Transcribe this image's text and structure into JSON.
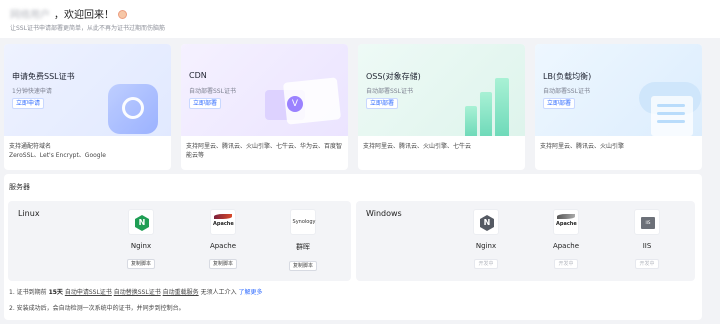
{
  "welcome": {
    "username": "网络用户",
    "greeting": "，欢迎回来！",
    "subtitle": "让SSL证书申请部署更简单，从此不再为证书过期而伤脑筋"
  },
  "cards": [
    {
      "title": "申请免费SSL证书",
      "desc": "1分钟快速申请",
      "button": "立即申请",
      "footer": "支持通配符域名\nZeroSSL、Let's Encrypt、Google"
    },
    {
      "title": "CDN",
      "desc": "自动部署SSL证书",
      "button": "立即部署",
      "footer": "支持阿里云、腾讯云、火山引擎、七牛云、华为云、百度智能云等"
    },
    {
      "title": "OSS(对象存储)",
      "desc": "自动部署SSL证书",
      "button": "立即部署",
      "footer": "支持阿里云、腾讯云、火山引擎、七牛云"
    },
    {
      "title": "LB(负载均衡)",
      "desc": "自动部署SSL证书",
      "button": "立即部署",
      "footer": "支持阿里云、腾讯云、火山引擎"
    }
  ],
  "servers": {
    "title": "服务器",
    "groups": [
      {
        "name": "Linux",
        "items": [
          {
            "name": "Nginx",
            "logo_text": "N",
            "button": "复制脚本"
          },
          {
            "name": "Apache",
            "logo_text": "Apache",
            "button": "复制脚本"
          },
          {
            "name": "群晖",
            "logo_text": "Synology",
            "button": "复制脚本"
          }
        ]
      },
      {
        "name": "Windows",
        "items": [
          {
            "name": "Nginx",
            "logo_text": "N",
            "button": "开发中"
          },
          {
            "name": "Apache",
            "logo_text": "Apache",
            "button": "开发中"
          },
          {
            "name": "IIS",
            "logo_text": "IIS",
            "button": "开发中"
          }
        ]
      }
    ]
  },
  "notes": {
    "line1": {
      "prefix": "1. 证书到期前",
      "days": "15天",
      "auto_apply": "自动申请SSL证书",
      "auto_replace": "自动替换SSL证书",
      "auto_restart": "自动重载服务",
      "no_manual": "无须人工介入",
      "learn_more": "了解更多"
    },
    "line2": "2. 安装成功后，会自动检测一次系统中的证书，并同步到控制台。"
  },
  "colors": {
    "accent": "#2f6bff",
    "nginx_green": "#1f9e54",
    "page_bg": "#f2f3f6"
  }
}
